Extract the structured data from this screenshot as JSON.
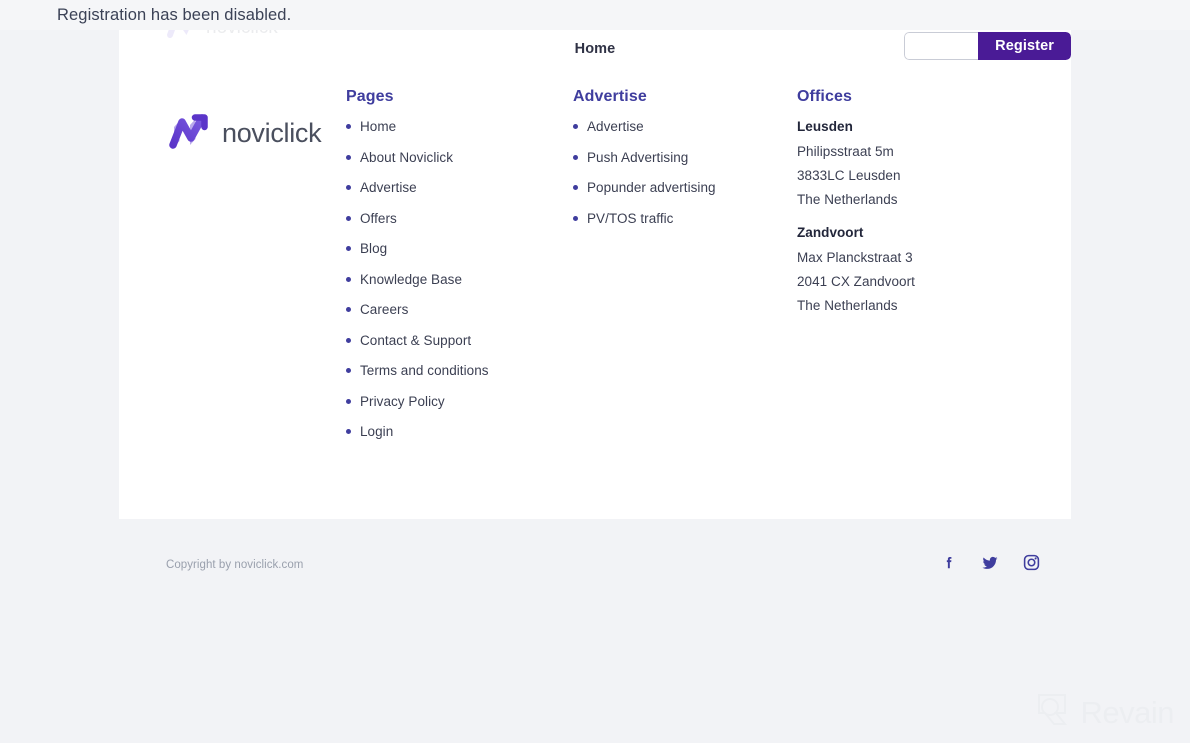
{
  "alert": {
    "message": "Registration has been disabled.",
    "background": "#f5f6f8"
  },
  "brand": {
    "name": "noviclick",
    "accent": "#4a1b96",
    "secondary_accent": "#3f3d9e",
    "logo_icon": "noviclick-arrow-logo-icon"
  },
  "header": {
    "nav": [
      {
        "label": "Home",
        "name": "nav-link-home"
      }
    ],
    "register": {
      "input_value": "",
      "input_placeholder": "",
      "button_label": "Register",
      "button_color": "#4a1b96"
    }
  },
  "footer": {
    "columns": [
      {
        "title": "Pages",
        "items": [
          "Home",
          "About Noviclick",
          "Advertise",
          "Offers",
          "Blog",
          "Knowledge Base",
          "Careers",
          "Contact & Support",
          "Terms and conditions",
          "Privacy Policy",
          "Login"
        ]
      },
      {
        "title": "Advertise",
        "items": [
          "Advertise",
          "Push Advertising",
          "Popunder advertising",
          "PV/TOS traffic"
        ]
      }
    ],
    "offices": {
      "title": "Offices",
      "locations": [
        {
          "city": "Leusden",
          "lines": [
            "Philipsstraat 5m",
            "3833LC Leusden",
            "The Netherlands"
          ]
        },
        {
          "city": "Zandvoort",
          "lines": [
            "Max Planckstraat 3",
            "2041 CX Zandvoort",
            "The Netherlands"
          ]
        }
      ]
    },
    "copyright": "Copyright by noviclick.com",
    "socials": [
      {
        "name": "facebook-icon",
        "label": "Facebook"
      },
      {
        "name": "twitter-icon",
        "label": "Twitter"
      },
      {
        "name": "instagram-icon",
        "label": "Instagram"
      }
    ]
  },
  "watermark": {
    "text": "Revain",
    "icon": "revain-logo-icon"
  }
}
